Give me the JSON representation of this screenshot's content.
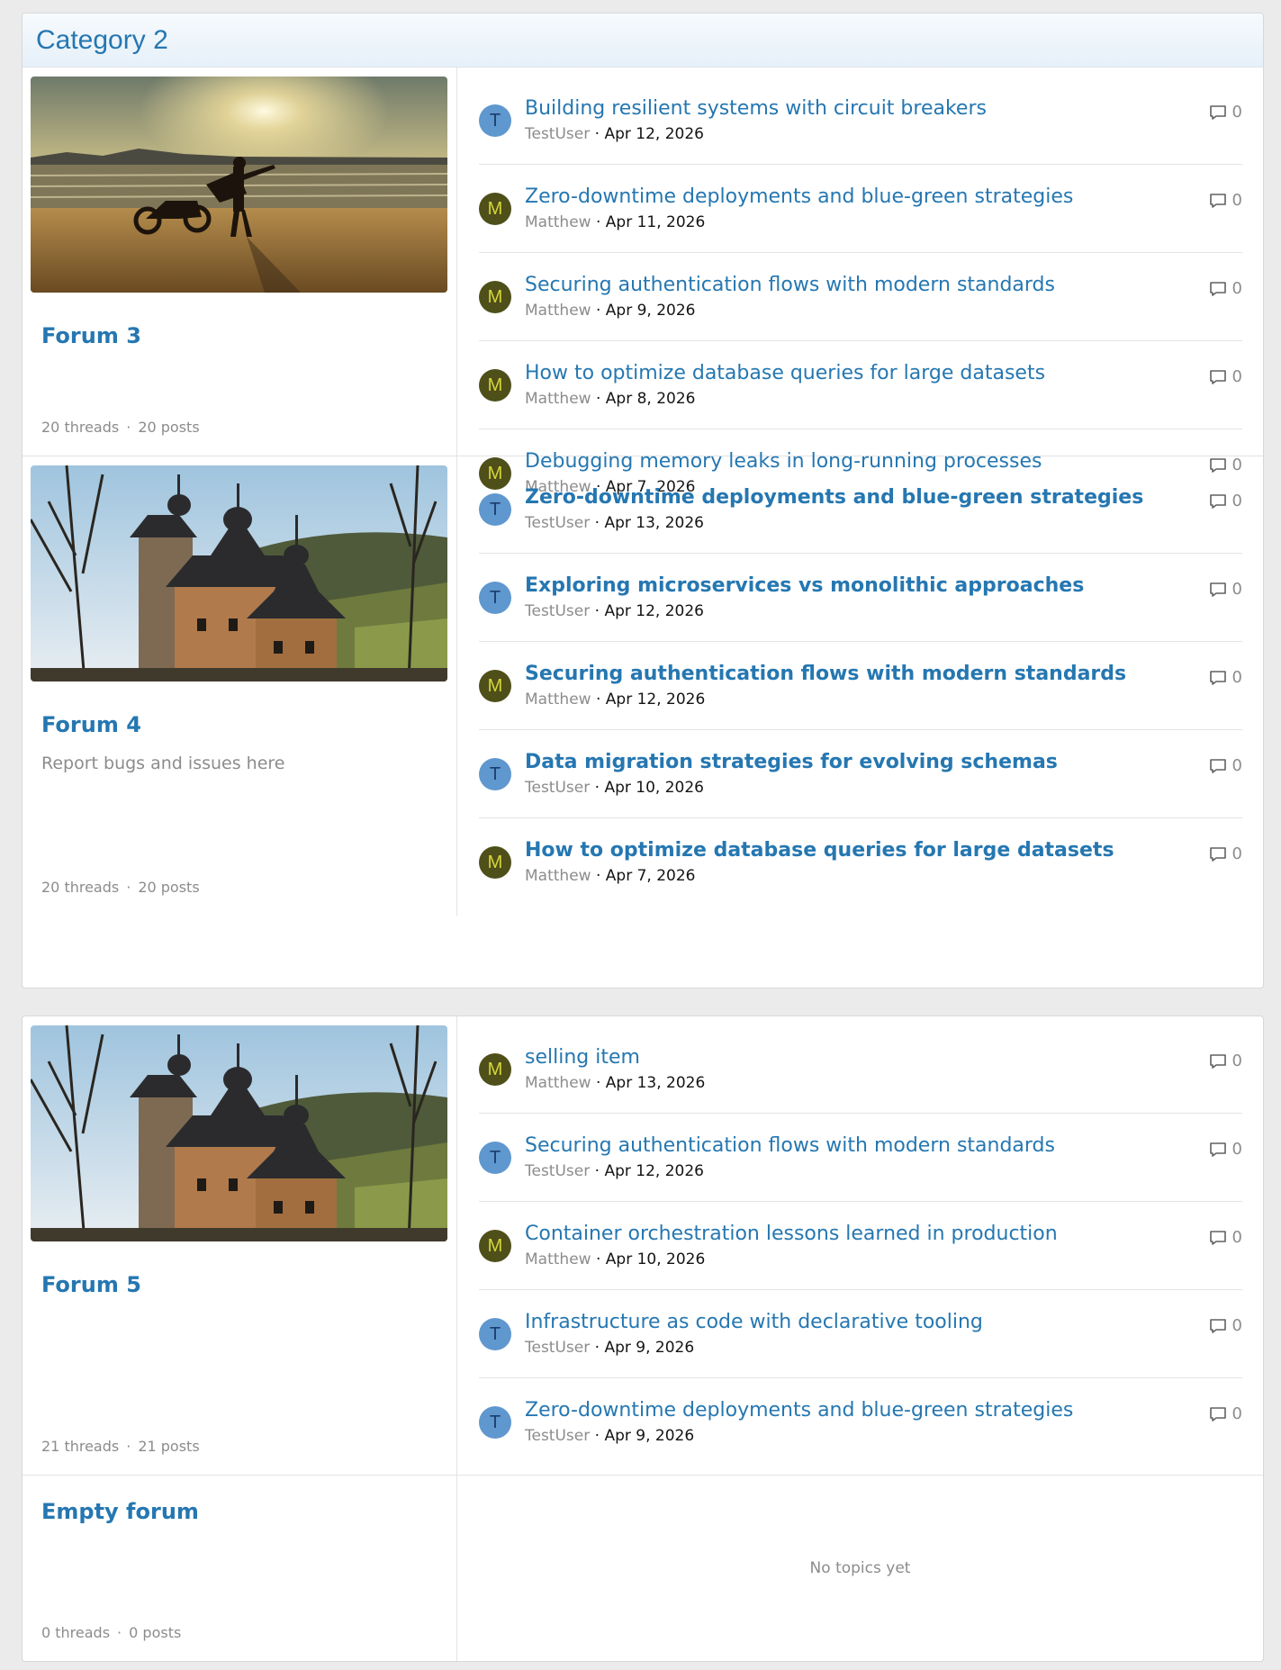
{
  "category": {
    "title": "Category 2"
  },
  "forums": [
    {
      "name": "Forum 3",
      "description": "",
      "threads": "20 threads",
      "posts": "20 posts",
      "image": "beach-sunset-motorcycle",
      "topics": [
        {
          "title": "Building resilient systems with circuit breakers",
          "user": "TestUser",
          "avatar": "T",
          "date": "Apr 12, 2026",
          "replies": "0"
        },
        {
          "title": "Zero-downtime deployments and blue-green strategies",
          "user": "Matthew",
          "avatar": "M",
          "date": "Apr 11, 2026",
          "replies": "0"
        },
        {
          "title": "Securing authentication flows with modern standards",
          "user": "Matthew",
          "avatar": "M",
          "date": "Apr 9, 2026",
          "replies": "0"
        },
        {
          "title": "How to optimize database queries for large datasets",
          "user": "Matthew",
          "avatar": "M",
          "date": "Apr 8, 2026",
          "replies": "0"
        },
        {
          "title": "Debugging memory leaks in long-running processes",
          "user": "Matthew",
          "avatar": "M",
          "date": "Apr 7, 2026",
          "replies": "0"
        }
      ]
    },
    {
      "name": "Forum 4",
      "description": "Report bugs and issues here",
      "threads": "20 threads",
      "posts": "20 posts",
      "image": "wooden-church",
      "topics": [
        {
          "title": "Zero-downtime deployments and blue-green strategies",
          "user": "TestUser",
          "avatar": "T",
          "date": "Apr 13, 2026",
          "replies": "0"
        },
        {
          "title": "Exploring microservices vs monolithic approaches",
          "user": "TestUser",
          "avatar": "T",
          "date": "Apr 12, 2026",
          "replies": "0"
        },
        {
          "title": "Securing authentication flows with modern standards",
          "user": "Matthew",
          "avatar": "M",
          "date": "Apr 12, 2026",
          "replies": "0"
        },
        {
          "title": "Data migration strategies for evolving schemas",
          "user": "TestUser",
          "avatar": "T",
          "date": "Apr 10, 2026",
          "replies": "0"
        },
        {
          "title": "How to optimize database queries for large datasets",
          "user": "Matthew",
          "avatar": "M",
          "date": "Apr 7, 2026",
          "replies": "0"
        }
      ]
    },
    {
      "name": "Forum 5",
      "description": "",
      "threads": "21 threads",
      "posts": "21 posts",
      "image": "wooden-church",
      "topics": [
        {
          "title": "selling item",
          "user": "Matthew",
          "avatar": "M",
          "date": "Apr 13, 2026",
          "replies": "0"
        },
        {
          "title": "Securing authentication flows with modern standards",
          "user": "TestUser",
          "avatar": "T",
          "date": "Apr 12, 2026",
          "replies": "0"
        },
        {
          "title": "Container orchestration lessons learned in production",
          "user": "Matthew",
          "avatar": "M",
          "date": "Apr 10, 2026",
          "replies": "0"
        },
        {
          "title": "Infrastructure as code with declarative tooling",
          "user": "TestUser",
          "avatar": "T",
          "date": "Apr 9, 2026",
          "replies": "0"
        },
        {
          "title": "Zero-downtime deployments and blue-green strategies",
          "user": "TestUser",
          "avatar": "T",
          "date": "Apr 9, 2026",
          "replies": "0"
        }
      ]
    },
    {
      "name": "Empty forum",
      "description": "",
      "threads": "0 threads",
      "posts": "0 posts",
      "empty_text": "No topics yet"
    }
  ],
  "colors": {
    "link": "#2577b1",
    "muted": "#8c8c8c",
    "avatar_t": "#5f97cf",
    "avatar_m": "#4f4f1a"
  },
  "icons": {
    "replies": "comment-bubble-icon"
  }
}
